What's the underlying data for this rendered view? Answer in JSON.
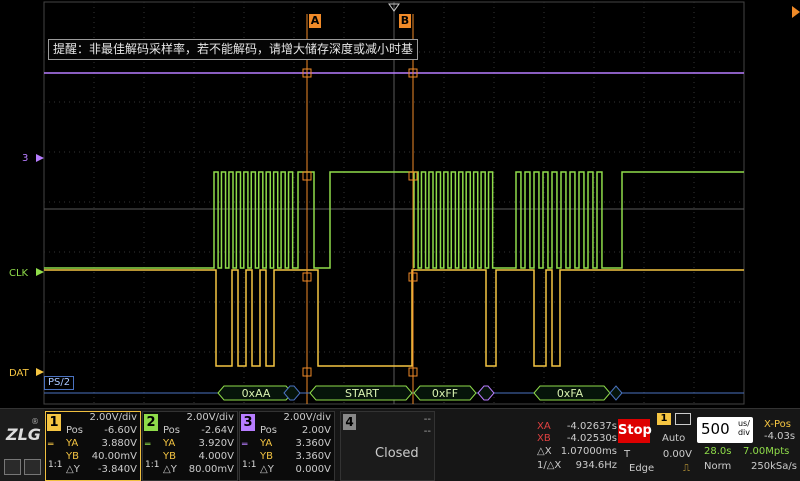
{
  "screen": {
    "hint": "提醒：非最佳解码采样率，若不能解码，请增大储存深度或减小时基",
    "cursor_a": "A",
    "cursor_b": "B",
    "channel_labels": {
      "ch3": "3",
      "clk": "CLK",
      "dat": "DAT"
    },
    "decode_label": "PS/2",
    "decode_frames": [
      "0xAA",
      "START",
      "0xFF",
      "0xFA"
    ]
  },
  "channels": [
    {
      "num": "1",
      "scale": "2.00V/div",
      "pos_label": "Pos",
      "pos": "-6.60V",
      "ya_label": "YA",
      "ya": "3.880V",
      "yb_label": "YB",
      "yb": "40.00mV",
      "dy_label": "△Y",
      "dy": "-3.840V",
      "color": "#f5c542"
    },
    {
      "num": "2",
      "scale": "2.00V/div",
      "pos_label": "Pos",
      "pos": "-2.64V",
      "ya_label": "YA",
      "ya": "3.920V",
      "yb_label": "YB",
      "yb": "4.000V",
      "dy_label": "△Y",
      "dy": "80.00mV",
      "color": "#8fdc4a"
    },
    {
      "num": "3",
      "scale": "2.00V/div",
      "pos_label": "Pos",
      "pos": "2.00V",
      "ya_label": "YA",
      "ya": "3.360V",
      "yb_label": "YB",
      "yb": "3.360V",
      "dy_label": "△Y",
      "dy": "0.000V",
      "color": "#b77dff"
    }
  ],
  "closed_channel": {
    "num": "4",
    "label": "Closed",
    "dashes": "--"
  },
  "measurements": {
    "xa_label": "XA",
    "xa": "-4.02637s",
    "xb_label": "XB",
    "xb": "-4.02530s",
    "dx_label": "△X",
    "dx": "1.07000ms",
    "inv_dx_label": "1/△X",
    "inv_dx": "934.6Hz"
  },
  "run": {
    "stop_label": "Stop"
  },
  "trigger": {
    "source": "1",
    "mode": "Auto",
    "type_label": "T",
    "level": "0.00V",
    "edge": "Edge"
  },
  "timebase": {
    "value": "500",
    "unit": "us/\ndiv",
    "sample_time": "28.0s",
    "memory": "7.00Mpts",
    "mode": "Norm",
    "rate": "250kSa/s"
  },
  "xpos": {
    "label": "X-Pos",
    "value": "-4.03s"
  },
  "logo": {
    "text": "ZLG",
    "reg": "®"
  },
  "colors": {
    "ch1": "#f5c542",
    "ch2": "#8fdc4a",
    "ch3": "#b77dff",
    "cursor": "#f08a28",
    "decode_border": "#8fdc4a"
  }
}
